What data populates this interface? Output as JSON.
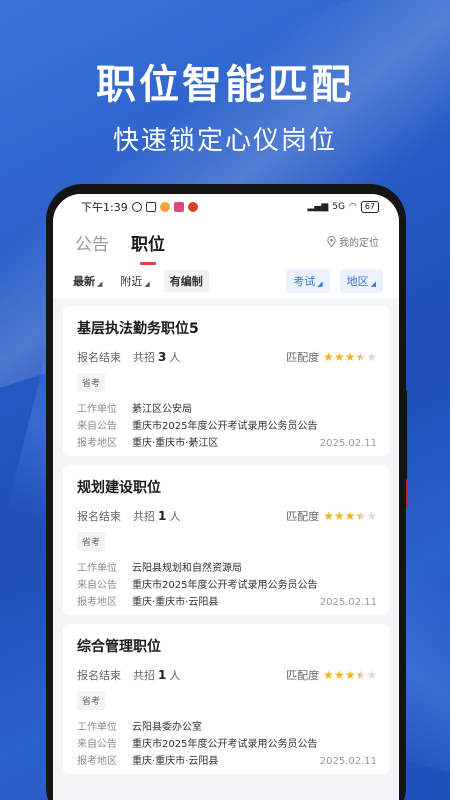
{
  "promo": {
    "title": "职位智能匹配",
    "subtitle": "快速锁定心仪岗位"
  },
  "status_bar": {
    "time": "下午1:39",
    "signal": "5G",
    "battery": "67"
  },
  "tabs": [
    {
      "label": "公告",
      "active": false
    },
    {
      "label": "职位",
      "active": true
    }
  ],
  "location": {
    "label": "我的定位"
  },
  "filters": {
    "latest": "最新",
    "nearby": "附近",
    "staffed": "有编制",
    "exam": "考试",
    "region": "地区"
  },
  "labels": {
    "match": "匹配度",
    "recruit_prefix": "共招",
    "recruit_suffix": "人",
    "employer": "工作单位",
    "source": "来自公告",
    "area": "报考地区"
  },
  "jobs": [
    {
      "title": "基层执法勤务职位5",
      "status": "报名结束",
      "count": "3",
      "rating": 3.5,
      "tag": "省考",
      "employer": "綦江区公安局",
      "source": "重庆市2025年度公开考试录用公务员公告",
      "area": "重庆·重庆市·綦江区",
      "date": "2025.02.11"
    },
    {
      "title": "规划建设职位",
      "status": "报名结束",
      "count": "1",
      "rating": 3.5,
      "tag": "省考",
      "employer": "云阳县规划和自然资源局",
      "source": "重庆市2025年度公开考试录用公务员公告",
      "area": "重庆·重庆市·云阳县",
      "date": "2025.02.11"
    },
    {
      "title": "综合管理职位",
      "status": "报名结束",
      "count": "1",
      "rating": 3.5,
      "tag": "省考",
      "employer": "云阳县委办公室",
      "source": "重庆市2025年度公开考试录用公务员公告",
      "area": "重庆·重庆市·云阳县",
      "date": "2025.02.11"
    }
  ],
  "colors": {
    "accent_red": "#e0403a",
    "accent_blue": "#3a78d8",
    "star": "#f2b51c"
  }
}
